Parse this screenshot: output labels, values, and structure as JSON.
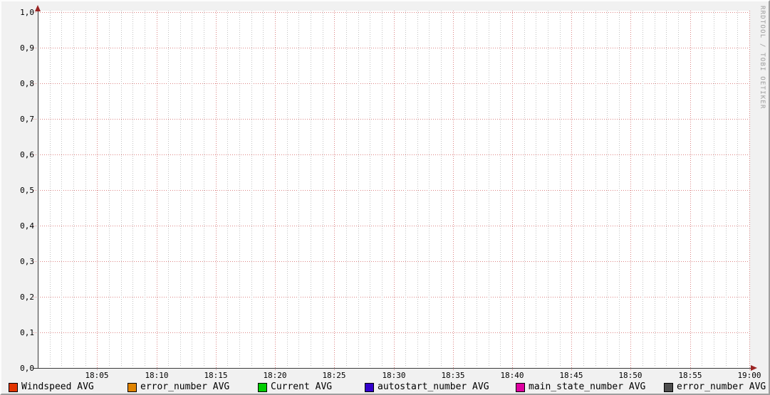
{
  "watermark": "RRDTOOL / TOBI OETIKER",
  "colors": {
    "background": "#f1f1f1",
    "canvas": "#ffffff",
    "axis": "#3a3a3a",
    "arrow": "#9b2423",
    "major_grid": "#dc8484",
    "minor_grid": "#c2c2c2"
  },
  "chart_data": {
    "type": "line",
    "title": "",
    "xlabel": "",
    "ylabel": "",
    "x_range": [
      "18:00",
      "19:00"
    ],
    "x_ticks": [
      "18:05",
      "18:10",
      "18:15",
      "18:20",
      "18:25",
      "18:30",
      "18:35",
      "18:40",
      "18:45",
      "18:50",
      "18:55",
      "19:00"
    ],
    "x_minor_tick_minutes": 1,
    "y_ticks": [
      "1,0",
      "0,9",
      "0,8",
      "0,7",
      "0,6",
      "0,5",
      "0,4",
      "0,3",
      "0,2",
      "0,1",
      "0,0"
    ],
    "ylim": [
      0.0,
      1.0
    ],
    "grid": {
      "major": "red dotted",
      "minor": "gray dotted vertical per minute"
    },
    "legend_position": "bottom",
    "series": [
      {
        "name": "Windspeed AVG",
        "color": "#e23400",
        "values": []
      },
      {
        "name": "error_number AVG",
        "color": "#e08400",
        "values": []
      },
      {
        "name": "Current AVG",
        "color": "#00cc00",
        "values": []
      },
      {
        "name": "autostart_number AVG",
        "color": "#3300cc",
        "values": []
      },
      {
        "name": "main_state_number AVG",
        "color": "#dd00a0",
        "values": []
      },
      {
        "name": "error_number AVG",
        "color": "#4e4e4e",
        "values": []
      }
    ]
  }
}
